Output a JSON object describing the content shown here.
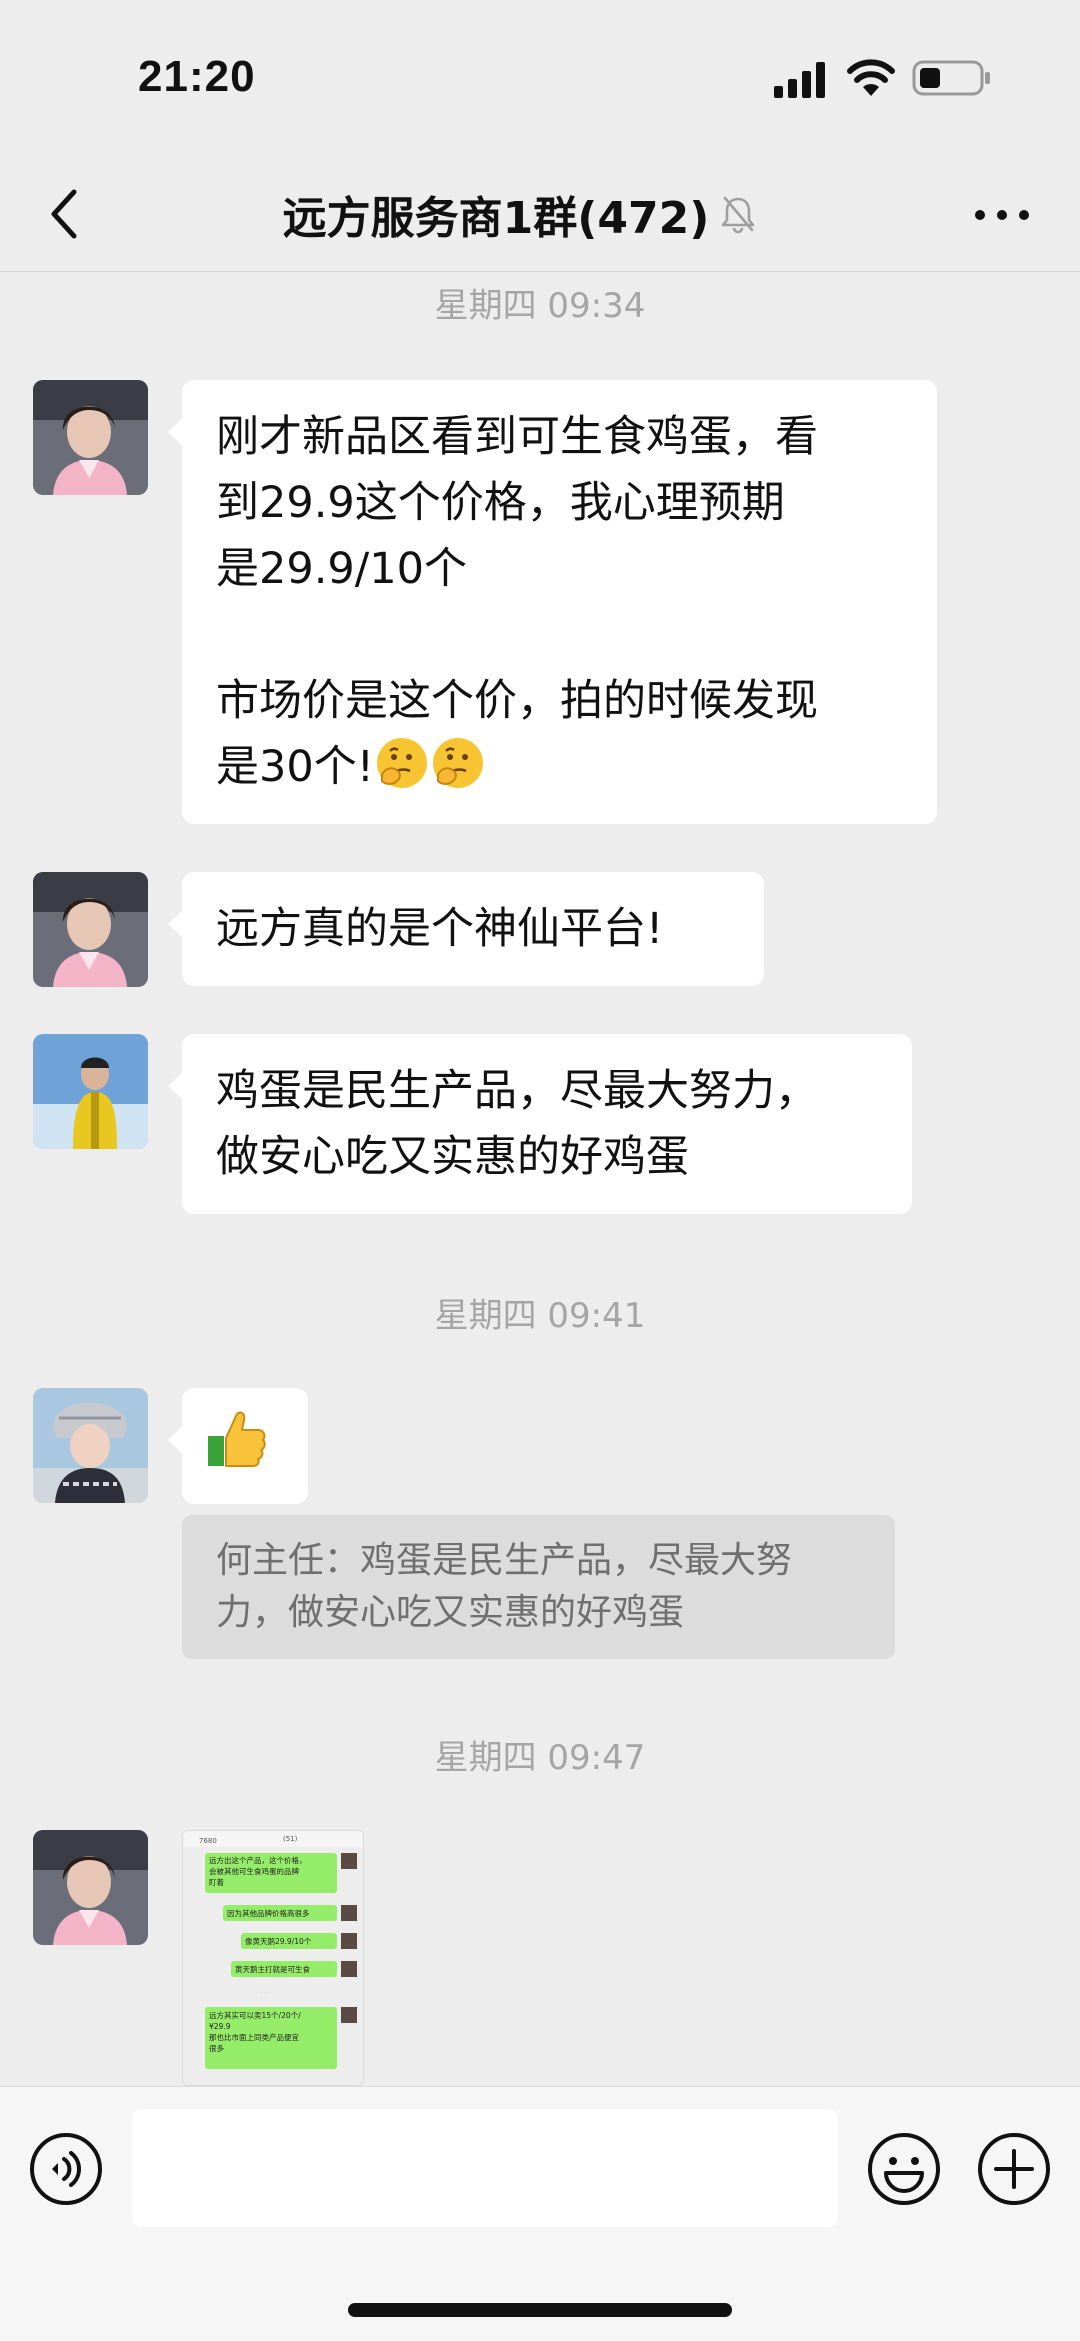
{
  "status": {
    "time": "21:20",
    "icons": [
      "signal-icon",
      "wifi-icon",
      "battery-icon"
    ]
  },
  "header": {
    "title": "远方服务商1群(472)",
    "icons": [
      "back-icon",
      "mute-bell-icon",
      "more-icon"
    ]
  },
  "timestamps": [
    "星期四 09:34",
    "星期四 09:41",
    "星期四 09:47"
  ],
  "messages": [
    {
      "text_lines": [
        "刚才新品区看到可生食鸡蛋，看",
        "到29.9这个价格，我心理预期",
        "是29.9/10个",
        "",
        "市场价是这个价，拍的时候发现",
        "是30个!"
      ],
      "emojis": [
        "thinking-face",
        "thinking-face"
      ]
    },
    {
      "text": "远方真的是个神仙平台!"
    },
    {
      "text_lines": [
        "鸡蛋是民生产品，尽最大努力，",
        "做安心吃又实惠的好鸡蛋"
      ]
    },
    {
      "emoji": "thumbs-up",
      "quote_lines": [
        "何主任：鸡蛋是民生产品，尽最大努",
        "力，做安心吃又实惠的好鸡蛋"
      ]
    },
    {
      "image": "chat-screenshot",
      "image_text": {
        "header": "(51)",
        "badge": "7680",
        "lines": [
          "远方出这个产品，这个价格，会被其他可生食鸡蛋的品牌盯着",
          "因为其他品牌价格高很多",
          "像黄天鹅29.9/10个",
          "黄天鹅主打就是可生食",
          "远方其实可以卖15个/20个/ ¥29.9 那也比市面上同类产品便宜很多"
        ]
      }
    }
  ],
  "colors": {
    "background": "#ededed",
    "bubble": "#ffffff",
    "quote": "#dcdcdc",
    "timestamp": "#a5a5a5",
    "wechat_green": "#95ec69"
  },
  "input_bar": {
    "icons": [
      "voice-icon",
      "emoji-icon",
      "plus-icon"
    ]
  }
}
